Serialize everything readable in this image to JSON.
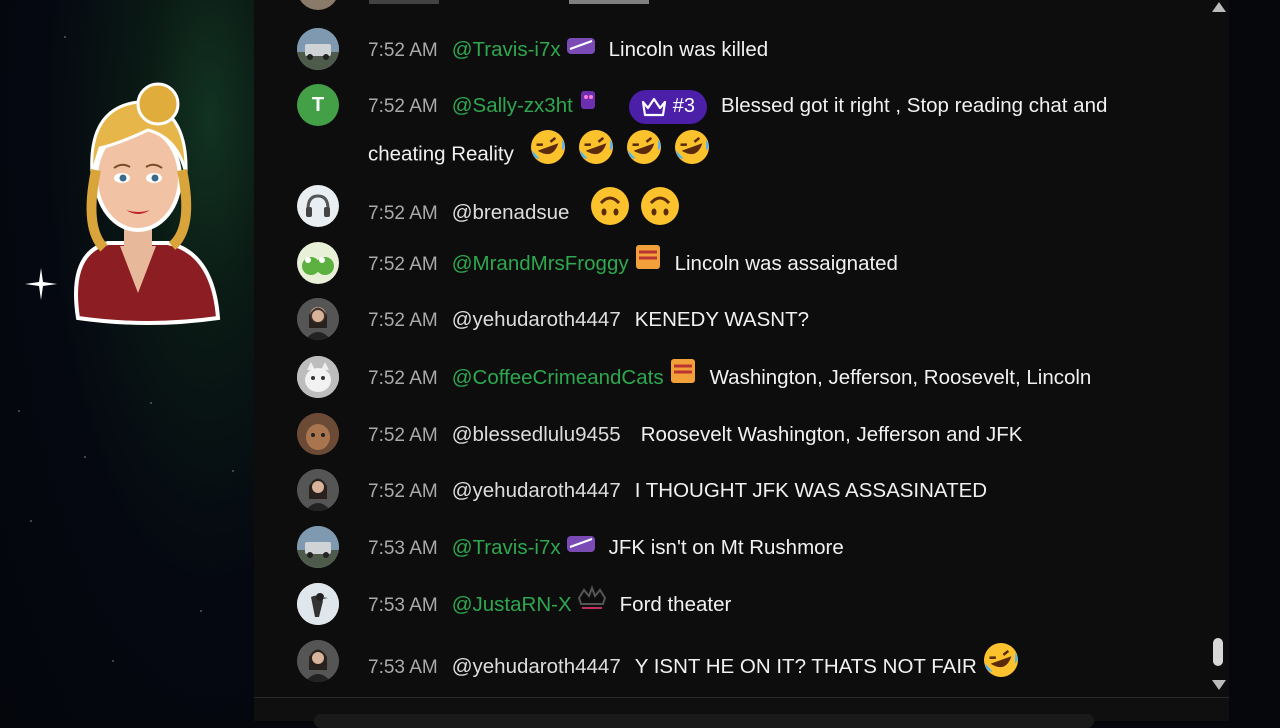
{
  "chat": {
    "messages": [
      {
        "time": "7:52 AM",
        "author": "@Travis-i7x",
        "text": "Lincoln was killed",
        "emojis": 0
      },
      {
        "time": "7:52 AM",
        "author": "@Sally-zx3ht",
        "rank": "#3",
        "avatar_letter": "T",
        "text": "Blessed got it right , Stop reading chat and",
        "text2": "cheating Reality",
        "emojis": 4
      },
      {
        "time": "7:52 AM",
        "author": "@brenadsue",
        "text": "",
        "emojis": 2
      },
      {
        "time": "7:52 AM",
        "author": "@MrandMrsFroggy",
        "text": "Lincoln was assaignated",
        "emojis": 0
      },
      {
        "time": "7:52 AM",
        "author": "@yehudaroth4447",
        "text": "KENEDY WASNT?",
        "emojis": 0
      },
      {
        "time": "7:52 AM",
        "author": "@CoffeeCrimeandCats",
        "text": "Washington, Jefferson, Roosevelt, Lincoln",
        "emojis": 0
      },
      {
        "time": "7:52 AM",
        "author": "@blessedlulu9455",
        "text": "Roosevelt Washington, Jefferson and JFK",
        "emojis": 0
      },
      {
        "time": "7:52 AM",
        "author": "@yehudaroth4447",
        "text": "I THOUGHT JFK WAS ASSASINATED",
        "emojis": 0
      },
      {
        "time": "7:53 AM",
        "author": "@Travis-i7x",
        "text": "JFK isn't on Mt Rushmore",
        "emojis": 0
      },
      {
        "time": "7:53 AM",
        "author": "@JustaRN-X",
        "text": "Ford theater",
        "emojis": 0
      },
      {
        "time": "7:53 AM",
        "author": "@yehudaroth4447",
        "text": "Y ISNT HE ON IT? THATS NOT FAIR",
        "emojis": 1
      }
    ]
  },
  "colors": {
    "member_name": "#2ea84e",
    "timestamp": "#aaaaaa",
    "rank_pill": "#4b1fa8",
    "chat_bg": "#0d0d0d"
  }
}
